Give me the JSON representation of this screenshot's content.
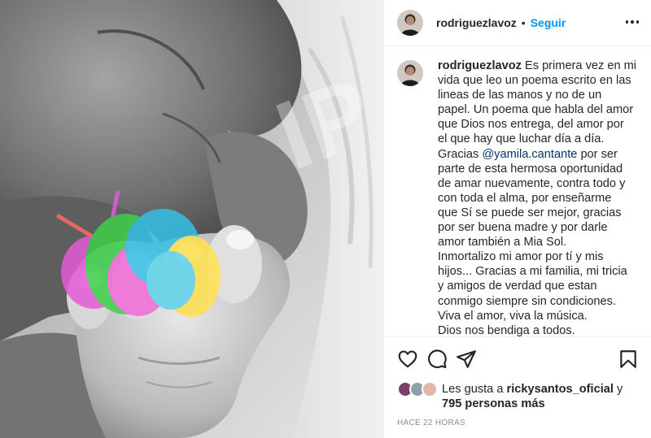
{
  "post": {
    "username": "rodriguezlavoz",
    "separator": "•",
    "follow_label": "Seguir",
    "more_icon": "more-options-icon",
    "caption_lines": [
      "Es primera vez en mi",
      "vida que leo un poema escrito en las",
      "lineas de las manos y no de un",
      "papel. Un poema que habla del amor",
      "que Dios nos entrega, del amor por",
      "el que hay que luchar día a día.",
      "Gracias",
      "por ser",
      "parte de esta hermosa oportunidad",
      "de amar nuevamente, contra todo y",
      "con toda el alma, por enseñarme",
      "que Sí se puede ser mejor, gracias",
      "por ser buena madre y por darle",
      "amor también a Mia Sol.",
      "Inmortalizo mi amor por tí y mis",
      "hijos... Gracias a mi familia, mi tricia",
      "y amigos de verdad que estan",
      "conmigo siempre sin condiciones.",
      "Viva el amor, viva la música.",
      "Dios nos bendiga a todos."
    ],
    "mention": "@yamila.cantante",
    "actions": {
      "like_icon": "heart-icon",
      "comment_icon": "comment-icon",
      "share_icon": "share-icon",
      "save_icon": "bookmark-icon"
    },
    "likes": {
      "prefix": "Les gusta a",
      "user": "rickysantos_oficial",
      "conj": "y",
      "count_text": "795 personas más"
    },
    "timestamp": "HACE 22 HORAS"
  },
  "colors": {
    "link_blue": "#0095f6",
    "mention_blue": "#00376b",
    "text": "#262626",
    "muted": "#8e8e8e",
    "divider": "#efefef"
  },
  "media": {
    "watermark_text": "IP"
  }
}
